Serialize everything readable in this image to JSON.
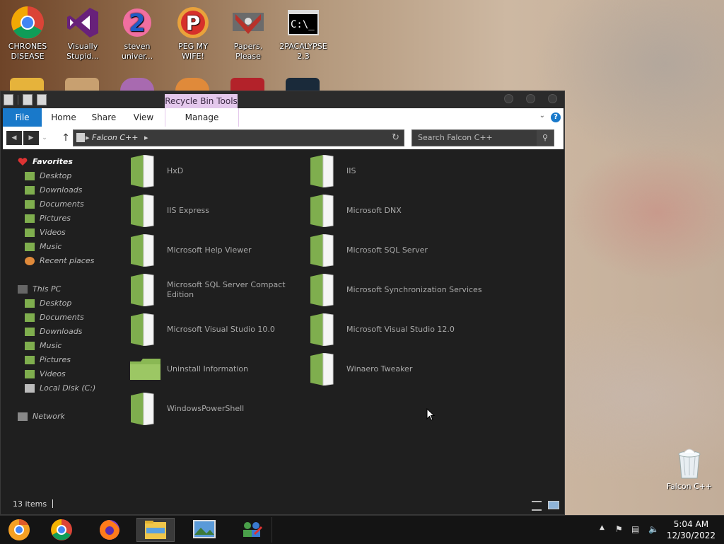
{
  "desktop": {
    "icons": [
      {
        "label": "CHRONES DISEASE",
        "icon": "chrome-icon"
      },
      {
        "label": "Visually Stupid...",
        "icon": "visual-studio-icon"
      },
      {
        "label": "steven univer...",
        "icon": "steven-universe-icon"
      },
      {
        "label": "PEG MY WIFE!",
        "icon": "peggle-icon"
      },
      {
        "label": "Papers, Please",
        "icon": "papers-please-icon"
      },
      {
        "label": "2PACALYPSE 2.3",
        "icon": "command-prompt-icon"
      }
    ],
    "recycle_bin": {
      "label": "Falcon C++",
      "icon": "recycle-bin-icon"
    }
  },
  "window": {
    "contextual_tab": "Recycle Bin Tools",
    "tabs": [
      "File",
      "Home",
      "Share",
      "View",
      "Manage"
    ],
    "address_crumb": "Falcon C++",
    "search_placeholder": "Search Falcon C++",
    "nav": {
      "favorites_label": "Favorites",
      "favorites": [
        "Desktop",
        "Downloads",
        "Documents",
        "Pictures",
        "Videos",
        "Music",
        "Recent places"
      ],
      "thispc_label": "This PC",
      "thispc": [
        "Desktop",
        "Documents",
        "Downloads",
        "Music",
        "Pictures",
        "Videos",
        "Local Disk (C:)"
      ],
      "network_label": "Network"
    },
    "folders": [
      "HxD",
      "IIS",
      "IIS Express",
      "Microsoft DNX",
      "Microsoft Help Viewer",
      "Microsoft SQL Server",
      "Microsoft SQL Server Compact Edition",
      "Microsoft Synchronization Services",
      "Microsoft Visual Studio 10.0",
      "Microsoft Visual Studio 12.0",
      "Uninstall Information",
      "Winaero Tweaker",
      "WindowsPowerShell"
    ],
    "status": "13 items"
  },
  "taskbar": {
    "apps": [
      "chrome-canary-icon",
      "chrome-icon",
      "firefox-icon",
      "file-explorer-icon",
      "photos-icon",
      "network-people-icon"
    ],
    "active_index": 3,
    "time": "5:04 AM",
    "date": "12/30/2022"
  },
  "colors": {
    "file_tab": "#1979ca",
    "contextual_tab": "#e4c8ec",
    "folder_green": "#7fae4e",
    "window_bg": "#1f1f1f"
  }
}
